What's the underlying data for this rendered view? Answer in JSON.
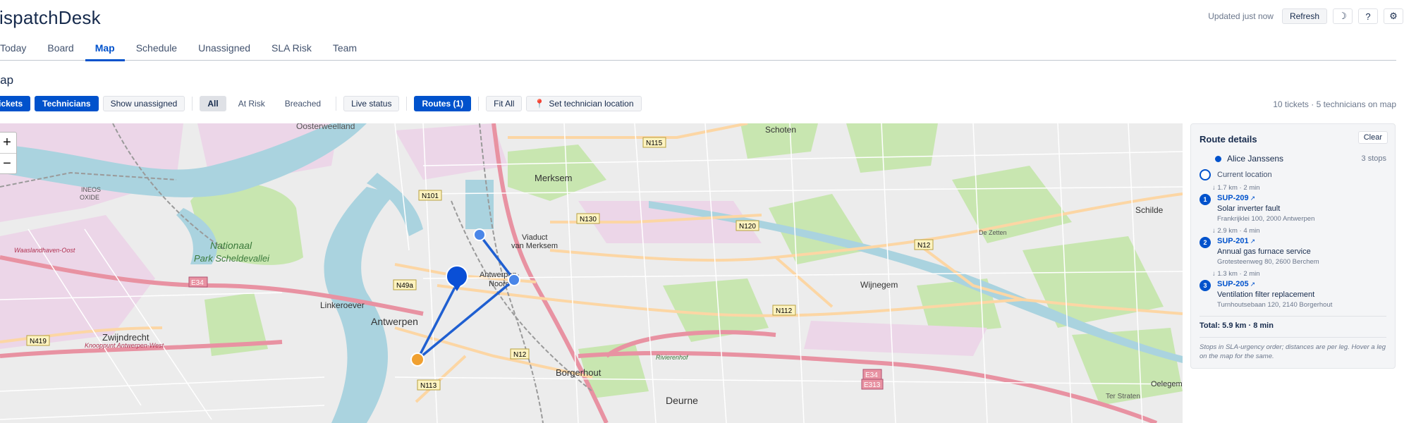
{
  "app": {
    "title": "DispatchDesk"
  },
  "header": {
    "updated": "Updated just now",
    "refresh_label": "Refresh",
    "theme_icon": "☽",
    "help_icon": "?",
    "settings_icon": "⚙"
  },
  "tabs": [
    {
      "label": "Today",
      "active": false
    },
    {
      "label": "Board",
      "active": false
    },
    {
      "label": "Map",
      "active": true
    },
    {
      "label": "Schedule",
      "active": false
    },
    {
      "label": "Unassigned",
      "active": false
    },
    {
      "label": "SLA Risk",
      "active": false
    },
    {
      "label": "Team",
      "active": false
    }
  ],
  "page": {
    "heading": "Map"
  },
  "filters": {
    "tickets": "Tickets",
    "technicians": "Technicians",
    "show_unassigned": "Show unassigned",
    "all": "All",
    "at_risk": "At Risk",
    "breached": "Breached",
    "live_status": "Live status",
    "routes": "Routes (1)",
    "fit_all": "Fit All",
    "set_location": "Set technician location"
  },
  "summary": "10 tickets · 5 technicians on map",
  "map": {
    "zoom_in": "+",
    "zoom_out": "−",
    "labels": {
      "oosterweelland": "Oosterweelland",
      "schoten": "Schoten",
      "merksem": "Merksem",
      "viaduct": "Viaduct",
      "van_merksem": "van Merksem",
      "schilde": "Schilde",
      "wijnegem": "Wijnegem",
      "deurne": "Deurne",
      "borgerhout": "Borgerhout",
      "antwerpen": "Antwerpen",
      "antwerpen_noord": "Antwerpen-",
      "noord": "Noord",
      "linkeroever": "Linkeroever",
      "zwijndrecht": "Zwijndrecht",
      "nationaal": "Nationaal",
      "park": "Park Scheldevallei",
      "ineos": "INEOS",
      "oxide": "OXIDE",
      "waaslandhaven": "Waaslandhaven-Oost",
      "ter_straten": "Ter Straten",
      "oelegem": "Oelegem",
      "de_zetten": "De Zetten",
      "rivierenhof": "Rivierenhof",
      "kp_west": "Knooppunt Antwerpen-West",
      "n115": "N115",
      "n130": "N130",
      "n120": "N120",
      "n12": "N12",
      "n12b": "N12",
      "n112": "N112",
      "n113": "N113",
      "n101": "N101",
      "n49a": "N49a",
      "n419": "N419",
      "e34": "E34",
      "e34b": "E34",
      "e313": "E313"
    }
  },
  "route_panel": {
    "title": "Route details",
    "clear": "Clear",
    "technician": "Alice Janssens",
    "stops_count": "3 stops",
    "start": "Current location",
    "legs": [
      "1.7 km · 2 min",
      "2.9 km · 4 min",
      "1.3 km · 2 min"
    ],
    "stops": [
      {
        "num": "1",
        "id": "SUP-209",
        "title": "Solar inverter fault",
        "address": "Frankrijklei 100, 2000 Antwerpen"
      },
      {
        "num": "2",
        "id": "SUP-201",
        "title": "Annual gas furnace service",
        "address": "Grotesteenweg 80, 2600 Berchem"
      },
      {
        "num": "3",
        "id": "SUP-205",
        "title": "Ventilation filter replacement",
        "address": "Turnhoutsebaan 120, 2140 Borgerhout"
      }
    ],
    "total": "Total: 5.9 km · 8 min",
    "note": "Stops in SLA-urgency order; distances are per leg. Hover a leg on the map for the same."
  },
  "colors": {
    "accent": "#0052cc",
    "marker_orange": "#f0a030",
    "route": "#1f5fd1"
  }
}
